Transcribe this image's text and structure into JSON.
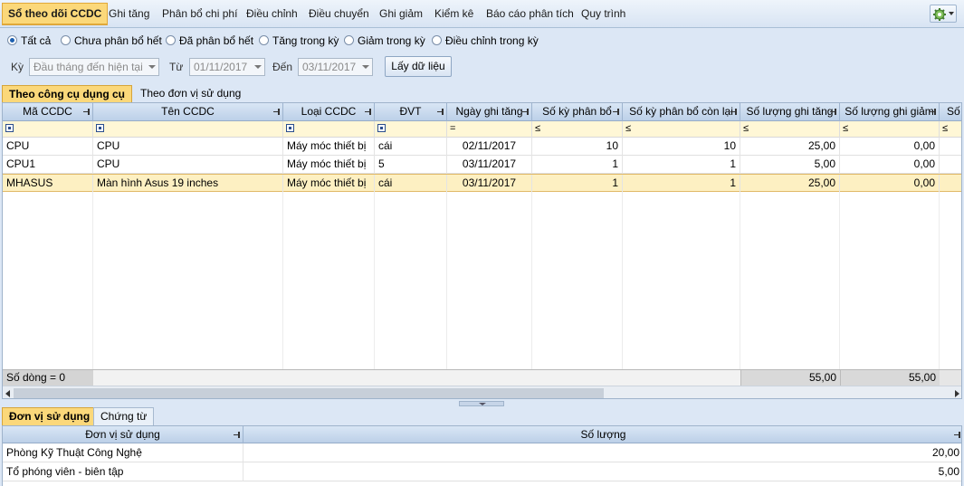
{
  "menu": {
    "items": [
      "Sổ theo dõi CCDC",
      "Ghi tăng",
      "Phân bổ chi phí",
      "Điều chỉnh",
      "Điều chuyển",
      "Ghi giảm",
      "Kiểm kê",
      "Báo cáo phân tích",
      "Quy trình"
    ],
    "active_index": 0,
    "settings_icon": "gear-icon"
  },
  "filters": {
    "radio_options": [
      "Tất cả",
      "Chưa phân bổ hết",
      "Đã phân bổ hết",
      "Tăng trong kỳ",
      "Giảm trong kỳ",
      "Điều chỉnh trong kỳ"
    ],
    "selected_index": 0,
    "period_label": "Kỳ",
    "period_value": "Đầu tháng đến hiện tại",
    "from_label": "Từ",
    "from_value": "01/11/2017",
    "to_label": "Đến",
    "to_value": "03/11/2017",
    "load_button": "Lấy dữ liệu"
  },
  "main_tabs": [
    "Theo công cụ dụng cụ",
    "Theo đơn vị sử dụng"
  ],
  "grid": {
    "columns": [
      "Mã CCDC",
      "Tên CCDC",
      "Loại CCDC",
      "ĐVT",
      "Ngày ghi tăng",
      "Số kỳ phân bổ",
      "Số kỳ phân bổ còn lại",
      "Số lượng ghi tăng",
      "Số lượng ghi giảm",
      "Số"
    ],
    "filter_ops": [
      "",
      "",
      "",
      "",
      "=",
      "≤",
      "≤",
      "≤",
      "≤",
      "≤"
    ],
    "rows": [
      [
        "CPU",
        "CPU",
        "Máy móc thiết bị",
        "cái",
        "02/11/2017",
        "10",
        "10",
        "25,00",
        "0,00"
      ],
      [
        "CPU1",
        "CPU",
        "Máy móc thiết bị",
        "5",
        "03/11/2017",
        "1",
        "1",
        "5,00",
        "0,00"
      ],
      [
        "MHASUS",
        "Màn hình Asus 19 inches",
        "Máy móc thiết bị",
        "cái",
        "03/11/2017",
        "1",
        "1",
        "25,00",
        "0,00"
      ]
    ],
    "selected_row": 2,
    "row_count_label": "Số dòng = 0",
    "total_increase": "55,00",
    "total_decrease": "55,00"
  },
  "bottom_tabs": [
    "Đơn vị sử dụng",
    "Chứng từ"
  ],
  "bottom_grid": {
    "columns": [
      "Đơn vị sử dụng",
      "Số lượng"
    ],
    "rows": [
      [
        "Phòng Kỹ Thuật Công Nghệ",
        "20,00"
      ],
      [
        "Tổ phóng viên - biên tập",
        "5,00"
      ]
    ]
  },
  "colors": {
    "active_tab": "#fbd87a",
    "selected_row": "#fdf0c2",
    "header": "#c8daee",
    "background": "#dce7f5"
  }
}
